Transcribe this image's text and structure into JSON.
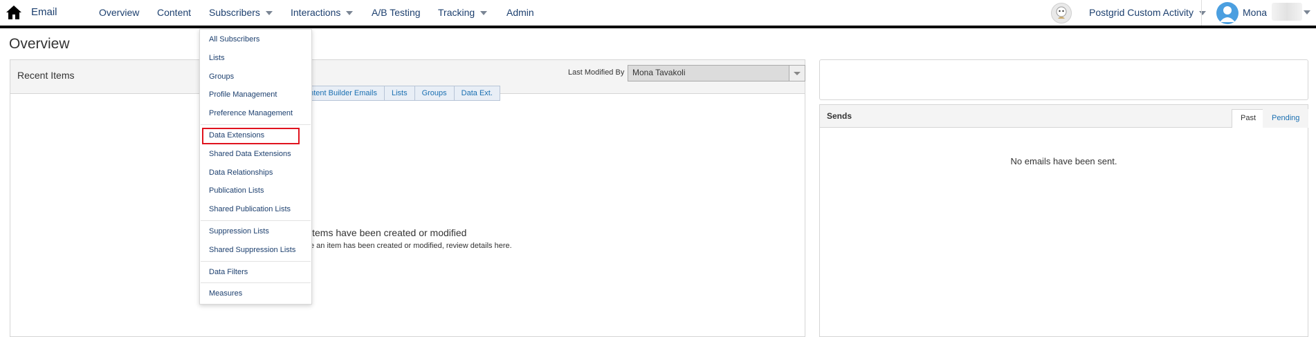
{
  "app": {
    "name": "Email"
  },
  "nav": {
    "items": [
      {
        "label": "Overview"
      },
      {
        "label": "Content"
      },
      {
        "label": "Subscribers"
      },
      {
        "label": "Interactions"
      },
      {
        "label": "A/B Testing"
      },
      {
        "label": "Tracking"
      },
      {
        "label": "Admin"
      }
    ],
    "business_unit": "Postgrid Custom Activity",
    "user_name": "Mona"
  },
  "page": {
    "title": "Overview"
  },
  "recent_items": {
    "title": "Recent Items",
    "last_modified_label": "Last Modified By",
    "last_modified_value": "Mona Tavakoli",
    "tabs": [
      "ontent Builder Emails",
      "Lists",
      "Groups",
      "Data Ext."
    ],
    "empty_title": "items have been created or modified",
    "empty_sub": "e an item has been created or modified, review details here."
  },
  "sends": {
    "title": "Sends",
    "tabs": {
      "past": "Past",
      "pending": "Pending"
    },
    "empty": "No emails have been sent."
  },
  "subscribers_menu": {
    "items": [
      "All Subscribers",
      "Lists",
      "Groups",
      "Profile Management",
      "Preference Management",
      "Data Extensions",
      "Shared Data Extensions",
      "Data Relationships",
      "Publication Lists",
      "Shared Publication Lists",
      "Suppression Lists",
      "Shared Suppression Lists",
      "Data Filters",
      "Measures"
    ],
    "highlighted": "Data Extensions"
  },
  "colors": {
    "nav_text": "#1c3f6e",
    "link": "#1a6fb1",
    "highlight": "#e0131e",
    "avatar": "#4b9fe0"
  }
}
